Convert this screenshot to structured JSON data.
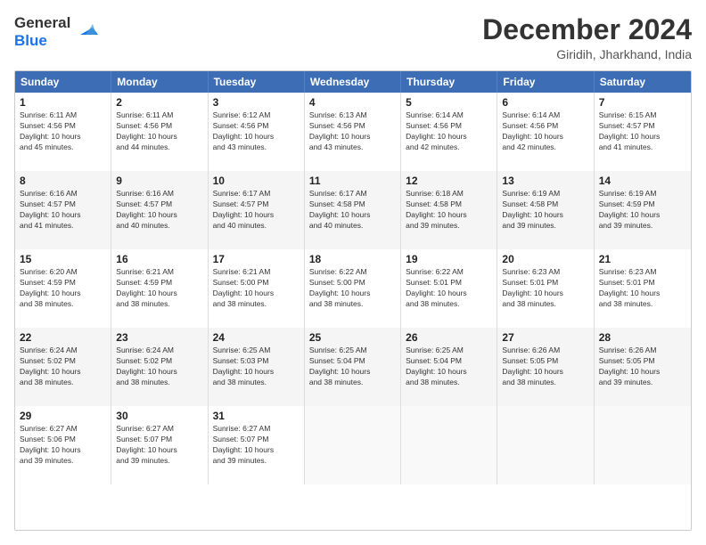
{
  "logo": {
    "line1": "General",
    "line2": "Blue"
  },
  "title": "December 2024",
  "location": "Giridih, Jharkhand, India",
  "days_of_week": [
    "Sunday",
    "Monday",
    "Tuesday",
    "Wednesday",
    "Thursday",
    "Friday",
    "Saturday"
  ],
  "rows": [
    [
      {
        "day": "1",
        "info": "Sunrise: 6:11 AM\nSunset: 4:56 PM\nDaylight: 10 hours\nand 45 minutes."
      },
      {
        "day": "2",
        "info": "Sunrise: 6:11 AM\nSunset: 4:56 PM\nDaylight: 10 hours\nand 44 minutes."
      },
      {
        "day": "3",
        "info": "Sunrise: 6:12 AM\nSunset: 4:56 PM\nDaylight: 10 hours\nand 43 minutes."
      },
      {
        "day": "4",
        "info": "Sunrise: 6:13 AM\nSunset: 4:56 PM\nDaylight: 10 hours\nand 43 minutes."
      },
      {
        "day": "5",
        "info": "Sunrise: 6:14 AM\nSunset: 4:56 PM\nDaylight: 10 hours\nand 42 minutes."
      },
      {
        "day": "6",
        "info": "Sunrise: 6:14 AM\nSunset: 4:56 PM\nDaylight: 10 hours\nand 42 minutes."
      },
      {
        "day": "7",
        "info": "Sunrise: 6:15 AM\nSunset: 4:57 PM\nDaylight: 10 hours\nand 41 minutes."
      }
    ],
    [
      {
        "day": "8",
        "info": "Sunrise: 6:16 AM\nSunset: 4:57 PM\nDaylight: 10 hours\nand 41 minutes."
      },
      {
        "day": "9",
        "info": "Sunrise: 6:16 AM\nSunset: 4:57 PM\nDaylight: 10 hours\nand 40 minutes."
      },
      {
        "day": "10",
        "info": "Sunrise: 6:17 AM\nSunset: 4:57 PM\nDaylight: 10 hours\nand 40 minutes."
      },
      {
        "day": "11",
        "info": "Sunrise: 6:17 AM\nSunset: 4:58 PM\nDaylight: 10 hours\nand 40 minutes."
      },
      {
        "day": "12",
        "info": "Sunrise: 6:18 AM\nSunset: 4:58 PM\nDaylight: 10 hours\nand 39 minutes."
      },
      {
        "day": "13",
        "info": "Sunrise: 6:19 AM\nSunset: 4:58 PM\nDaylight: 10 hours\nand 39 minutes."
      },
      {
        "day": "14",
        "info": "Sunrise: 6:19 AM\nSunset: 4:59 PM\nDaylight: 10 hours\nand 39 minutes."
      }
    ],
    [
      {
        "day": "15",
        "info": "Sunrise: 6:20 AM\nSunset: 4:59 PM\nDaylight: 10 hours\nand 38 minutes."
      },
      {
        "day": "16",
        "info": "Sunrise: 6:21 AM\nSunset: 4:59 PM\nDaylight: 10 hours\nand 38 minutes."
      },
      {
        "day": "17",
        "info": "Sunrise: 6:21 AM\nSunset: 5:00 PM\nDaylight: 10 hours\nand 38 minutes."
      },
      {
        "day": "18",
        "info": "Sunrise: 6:22 AM\nSunset: 5:00 PM\nDaylight: 10 hours\nand 38 minutes."
      },
      {
        "day": "19",
        "info": "Sunrise: 6:22 AM\nSunset: 5:01 PM\nDaylight: 10 hours\nand 38 minutes."
      },
      {
        "day": "20",
        "info": "Sunrise: 6:23 AM\nSunset: 5:01 PM\nDaylight: 10 hours\nand 38 minutes."
      },
      {
        "day": "21",
        "info": "Sunrise: 6:23 AM\nSunset: 5:01 PM\nDaylight: 10 hours\nand 38 minutes."
      }
    ],
    [
      {
        "day": "22",
        "info": "Sunrise: 6:24 AM\nSunset: 5:02 PM\nDaylight: 10 hours\nand 38 minutes."
      },
      {
        "day": "23",
        "info": "Sunrise: 6:24 AM\nSunset: 5:02 PM\nDaylight: 10 hours\nand 38 minutes."
      },
      {
        "day": "24",
        "info": "Sunrise: 6:25 AM\nSunset: 5:03 PM\nDaylight: 10 hours\nand 38 minutes."
      },
      {
        "day": "25",
        "info": "Sunrise: 6:25 AM\nSunset: 5:04 PM\nDaylight: 10 hours\nand 38 minutes."
      },
      {
        "day": "26",
        "info": "Sunrise: 6:25 AM\nSunset: 5:04 PM\nDaylight: 10 hours\nand 38 minutes."
      },
      {
        "day": "27",
        "info": "Sunrise: 6:26 AM\nSunset: 5:05 PM\nDaylight: 10 hours\nand 38 minutes."
      },
      {
        "day": "28",
        "info": "Sunrise: 6:26 AM\nSunset: 5:05 PM\nDaylight: 10 hours\nand 39 minutes."
      }
    ],
    [
      {
        "day": "29",
        "info": "Sunrise: 6:27 AM\nSunset: 5:06 PM\nDaylight: 10 hours\nand 39 minutes."
      },
      {
        "day": "30",
        "info": "Sunrise: 6:27 AM\nSunset: 5:07 PM\nDaylight: 10 hours\nand 39 minutes."
      },
      {
        "day": "31",
        "info": "Sunrise: 6:27 AM\nSunset: 5:07 PM\nDaylight: 10 hours\nand 39 minutes."
      },
      {
        "day": "",
        "info": ""
      },
      {
        "day": "",
        "info": ""
      },
      {
        "day": "",
        "info": ""
      },
      {
        "day": "",
        "info": ""
      }
    ]
  ]
}
